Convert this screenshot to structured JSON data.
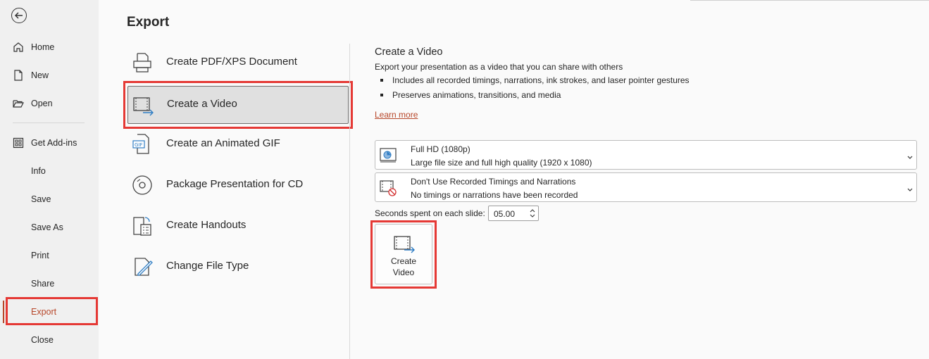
{
  "sidebar": {
    "items": [
      {
        "label": "Home",
        "icon": "home-icon"
      },
      {
        "label": "New",
        "icon": "new-document-icon"
      },
      {
        "label": "Open",
        "icon": "open-folder-icon"
      },
      {
        "label": "Get Add-ins",
        "icon": "add-ins-grid-icon"
      },
      {
        "label": "Info"
      },
      {
        "label": "Save"
      },
      {
        "label": "Save As"
      },
      {
        "label": "Print"
      },
      {
        "label": "Share"
      },
      {
        "label": "Export",
        "active": true
      },
      {
        "label": "Close"
      }
    ]
  },
  "page": {
    "title": "Export"
  },
  "options": [
    {
      "label": "Create PDF/XPS Document",
      "icon": "pdf-xps-document-icon"
    },
    {
      "label": "Create a Video",
      "icon": "video-icon",
      "selected": true
    },
    {
      "label": "Create an Animated GIF",
      "icon": "gif-icon"
    },
    {
      "label": "Package Presentation for CD",
      "icon": "cd-icon"
    },
    {
      "label": "Create Handouts",
      "icon": "handouts-icon"
    },
    {
      "label": "Change File Type",
      "icon": "change-file-type-icon"
    }
  ],
  "details": {
    "title": "Create a Video",
    "description": "Export your presentation as a video that you can share with others",
    "bullets": [
      "Includes all recorded timings, narrations, ink strokes, and laser pointer gestures",
      "Preserves animations, transitions, and media"
    ],
    "learn_more": "Learn more",
    "quality": {
      "title": "Full HD (1080p)",
      "subtitle": "Large file size and full high quality (1920 x 1080)",
      "icon": "monitor-quality-icon"
    },
    "timings": {
      "title": "Don't Use Recorded Timings and Narrations",
      "subtitle": "No timings or narrations have been recorded",
      "icon": "no-timings-icon"
    },
    "seconds_label": "Seconds spent on each slide:",
    "seconds_value": "05.00",
    "create_button": {
      "line1": "Create",
      "line2": "Video"
    }
  },
  "colors": {
    "accent": "#b7472a",
    "highlight_box": "#e53935",
    "sidebar_bg": "#f0f0f0",
    "page_bg": "#fafafa"
  }
}
